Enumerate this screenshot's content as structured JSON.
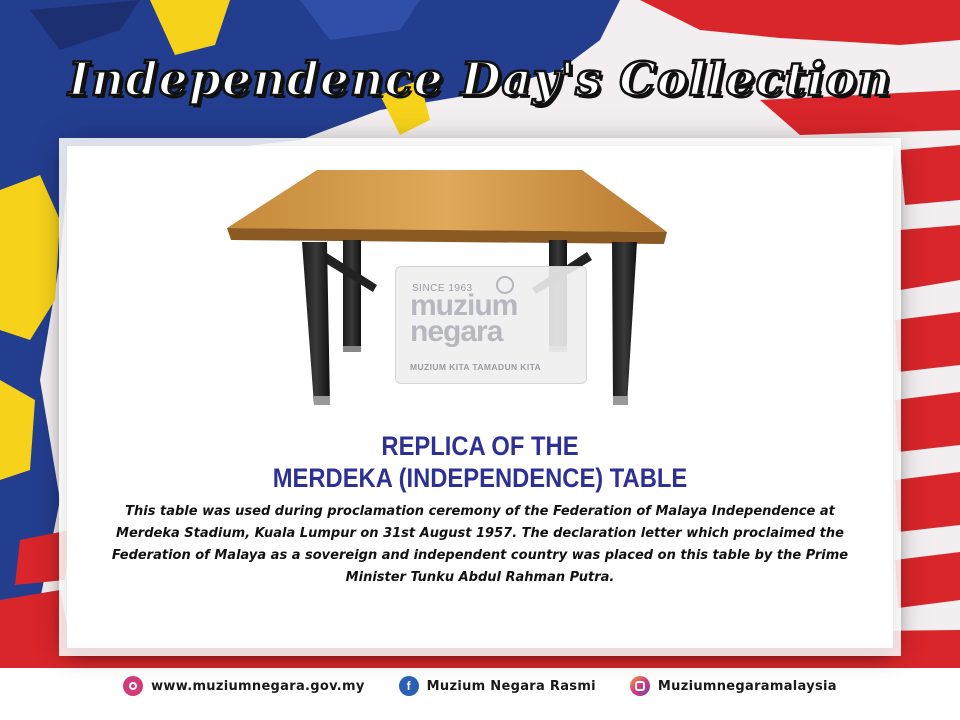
{
  "title": "Independence Day's Collection",
  "watermark": {
    "since": "SINCE 1963",
    "brand_line1": "muzium",
    "brand_line2": "negara",
    "tagline": "MUZIUM KITA TAMADUN KITA"
  },
  "heading": {
    "line1": "REPLICA OF THE",
    "line2": "MERDEKA (INDEPENDENCE) TABLE"
  },
  "description": "This table was used during proclamation ceremony of the Federation of Malaya Independence  at  Merdeka Stadium, Kuala Lumpur on 31st August 1957. The declaration letter which proclaimed the Federation  of Malaya as a  sovereign and independent country was placed on this table by the Prime Minister Tunku Abdul Rahman Putra.",
  "footer": {
    "website": "www.muziumnegara.gov.my",
    "facebook": "Muzium Negara Rasmi",
    "instagram": "Muziumnegaramalaysia"
  },
  "colors": {
    "heading": "#2e3194",
    "flag_red": "#d8262b",
    "flag_blue": "#243e8f",
    "flag_yellow": "#f6d21a"
  },
  "icons": [
    "website-icon",
    "facebook-icon",
    "instagram-icon"
  ]
}
